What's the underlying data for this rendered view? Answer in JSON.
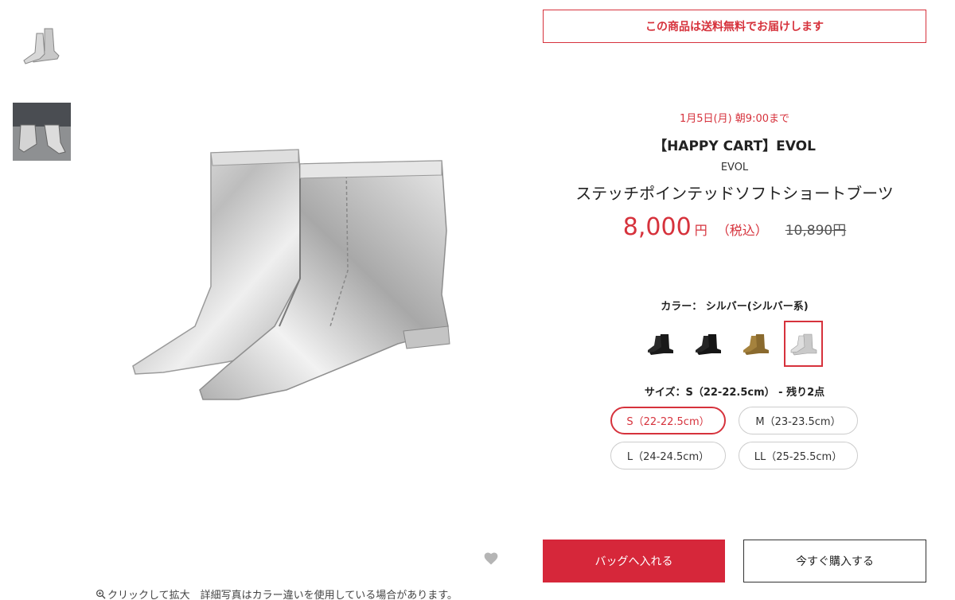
{
  "notice": {
    "free_shipping": "この商品は送料無料でお届けします"
  },
  "product": {
    "sale_until": "1月5日(月) 朝9:00まで",
    "campaign": "【HAPPY CART】EVOL",
    "brand": "EVOL",
    "name": "ステッチポインテッドソフトショートブーツ",
    "price": "8,000",
    "currency": "円",
    "tax_note": "（税込）",
    "original_price": "10,890円"
  },
  "color": {
    "label": "カラー： シルバー(シルバー系)",
    "swatches": [
      {
        "name": "black-1",
        "color": "#1a1a1a"
      },
      {
        "name": "black-2",
        "color": "#151515"
      },
      {
        "name": "brown",
        "color": "#8a6a2e"
      },
      {
        "name": "silver",
        "color": "#c9c9c9",
        "selected": true
      }
    ]
  },
  "size": {
    "label": "サイズ：S（22-22.5cm）  - 残り2点",
    "options": [
      "S（22-22.5cm）",
      "M（23-23.5cm）",
      "L（24-24.5cm）",
      "LL（25-25.5cm）"
    ],
    "selected": 0
  },
  "actions": {
    "add_to_bag": "バッグへ入れる",
    "buy_now": "今すぐ購入する"
  },
  "image_note": "クリックして拡大　詳細写真はカラー違いを使用している場合があります。",
  "colors": {
    "accent": "#d6323c"
  }
}
